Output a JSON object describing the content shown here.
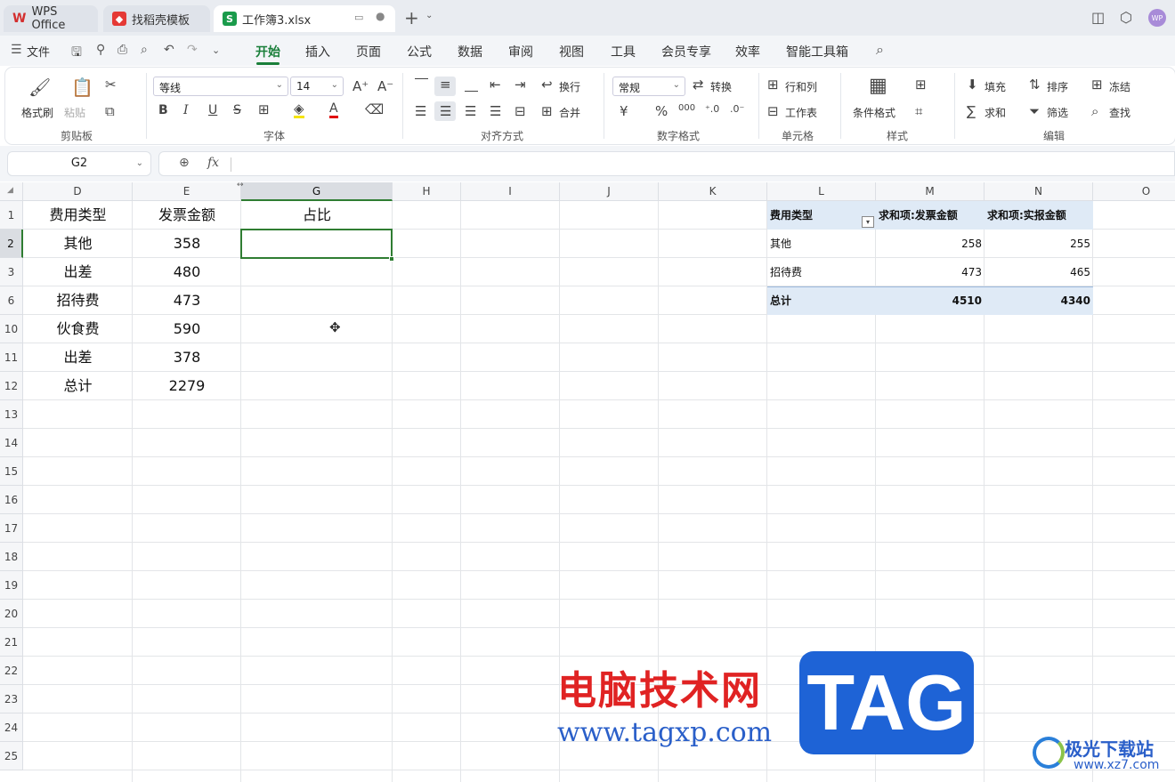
{
  "tabs": [
    {
      "label": "WPS Office"
    },
    {
      "label": "找稻壳模板"
    },
    {
      "label": "工作簿3.xlsx"
    }
  ],
  "menu": {
    "file": "文件",
    "items": [
      "开始",
      "插入",
      "页面",
      "公式",
      "数据",
      "审阅",
      "视图",
      "工具",
      "会员专享",
      "效率",
      "智能工具箱"
    ]
  },
  "avatar": "WP",
  "ribbon": {
    "clipboard": {
      "format_painter": "格式刷",
      "paste": "粘贴",
      "label": "剪贴板"
    },
    "font": {
      "name": "等线",
      "size": "14",
      "label": "字体",
      "bold": "B",
      "italic": "I",
      "underline": "U",
      "strike": "S",
      "fontcolor": "A"
    },
    "align": {
      "wrap": "换行",
      "merge": "合并",
      "label": "对齐方式"
    },
    "number": {
      "format": "常规",
      "convert": "转换",
      "label": "数字格式",
      "currency": "¥",
      "percent": "%",
      "thousand": "000"
    },
    "cells": {
      "rowcol": "行和列",
      "sheet": "工作表",
      "label": "单元格"
    },
    "style": {
      "cond": "条件格式",
      "label": "样式"
    },
    "edit": {
      "fill": "填充",
      "sort": "排序",
      "freeze": "冻结",
      "sum": "求和",
      "filter": "筛选",
      "find": "查找",
      "label": "编辑"
    }
  },
  "formula_bar": {
    "cell_ref": "G2",
    "fx": "fx",
    "formula": ""
  },
  "columns": [
    "D",
    "E",
    "G",
    "H",
    "I",
    "J",
    "K",
    "L",
    "M",
    "N",
    "O"
  ],
  "rows": [
    "1",
    "2",
    "3",
    "6",
    "10",
    "11",
    "12",
    "13",
    "14",
    "15",
    "16",
    "17",
    "18",
    "19",
    "20",
    "21",
    "22",
    "23",
    "24",
    "25"
  ],
  "table": {
    "headers": [
      "费用类型",
      "发票金额",
      "占比"
    ],
    "rows": [
      [
        "其他",
        "358"
      ],
      [
        "出差",
        "480"
      ],
      [
        "招待费",
        "473"
      ],
      [
        "伙食费",
        "590"
      ],
      [
        "出差",
        "378"
      ],
      [
        "总计",
        "2279"
      ]
    ]
  },
  "pivot": {
    "headers": [
      "费用类型",
      "求和项:发票金额",
      "求和项:实报金额"
    ],
    "rows": [
      [
        "其他",
        "258",
        "255"
      ],
      [
        "招待费",
        "473",
        "465"
      ]
    ],
    "total": [
      "总计",
      "4510",
      "4340"
    ]
  },
  "watermark": {
    "cn": "电脑技术网",
    "url": "www.tagxp.com",
    "tag": "TAG",
    "site": "极光下载站",
    "site_url": "www.xz7.com"
  }
}
